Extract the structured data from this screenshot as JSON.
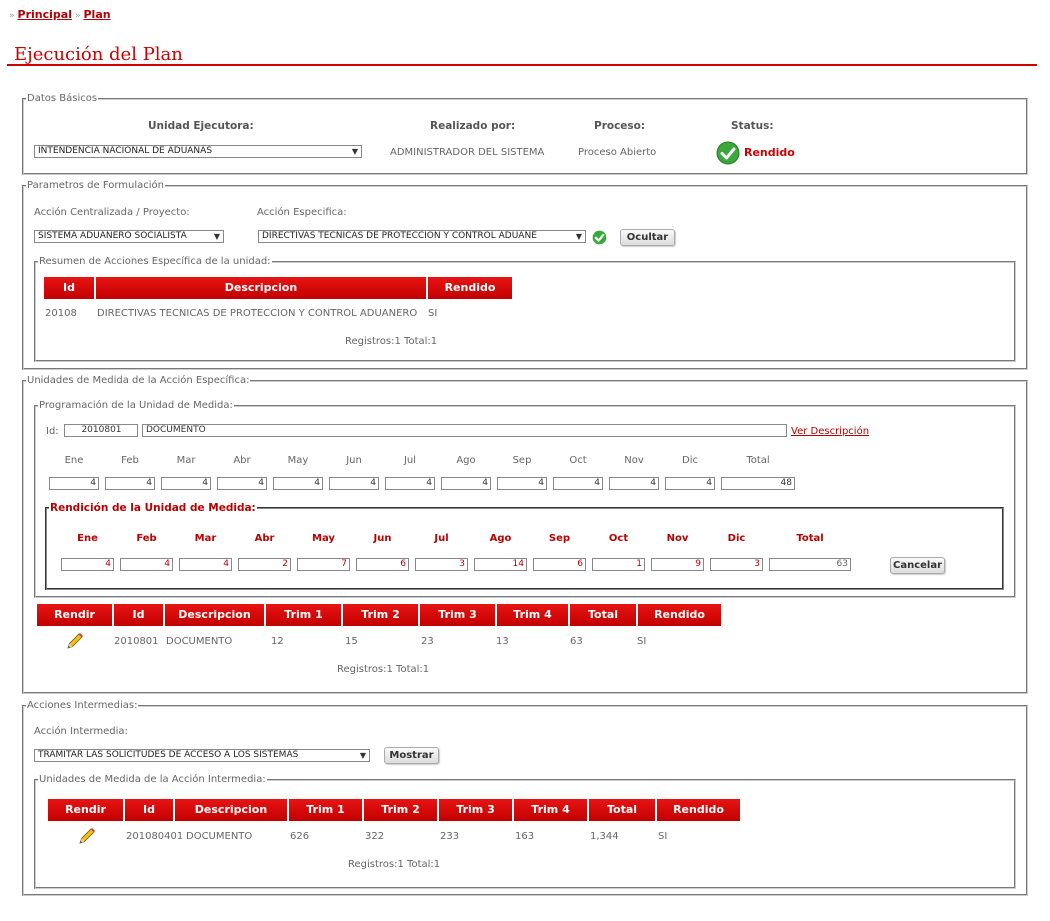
{
  "breadcrumb": {
    "home": "Principal",
    "current": "Plan",
    "sep": "»"
  },
  "page_title": "Ejecución del Plan",
  "datos": {
    "legend": "Datos Básicos",
    "unidad_label": "Unidad Ejecutora:",
    "realizado_label": "Realizado por:",
    "proceso_label": "Proceso:",
    "status_label": "Status:",
    "unidad_value": "INTENDENCIA NACIONAL DE ADUANAS",
    "realizado_value": "ADMINISTRADOR DEL SISTEMA",
    "proceso_value": "Proceso Abierto",
    "status_value": "Rendido"
  },
  "parametros": {
    "legend": "Parametros de Formulación",
    "accion_label": "Acción Centralizada / Proyecto:",
    "especifica_label": "Acción Especifica:",
    "accion_value": "SISTEMA ADUANERO SOCIALISTA",
    "especifica_value": "DIRECTIVAS TECNICAS DE PROTECCION Y CONTROL ADUANE",
    "ocultar": "Ocultar",
    "resumen": {
      "legend": "Resumen de Acciones Específica de la unidad:",
      "headers": [
        "Id",
        "Descripcion",
        "Rendido"
      ],
      "row": [
        "20108",
        "DIRECTIVAS TECNICAS DE PROTECCION Y CONTROL ADUANERO",
        "SI"
      ],
      "footer": "Registros:1 Total:1"
    }
  },
  "unidades": {
    "legend": "Unidades de Medida de la Acción Específica:",
    "prog": {
      "legend": "Programación de la Unidad de Medida:",
      "id_label": "Id:",
      "id_value": "2010801",
      "desc_value": "DOCUMENTO",
      "ver_desc": "Ver Descripción",
      "months": [
        "Ene",
        "Feb",
        "Mar",
        "Abr",
        "May",
        "Jun",
        "Jul",
        "Ago",
        "Sep",
        "Oct",
        "Nov",
        "Dic"
      ],
      "total_label": "Total",
      "values": [
        "4",
        "4",
        "4",
        "4",
        "4",
        "4",
        "4",
        "4",
        "4",
        "4",
        "4",
        "4"
      ],
      "total": "48"
    },
    "rend": {
      "legend": "Rendición de la Unidad de Medida:",
      "months": [
        "Ene",
        "Feb",
        "Mar",
        "Abr",
        "May",
        "Jun",
        "Jul",
        "Ago",
        "Sep",
        "Oct",
        "Nov",
        "Dic"
      ],
      "total_label": "Total",
      "values": [
        "4",
        "4",
        "4",
        "2",
        "7",
        "6",
        "3",
        "14",
        "6",
        "1",
        "9",
        "3"
      ],
      "total": "63",
      "cancelar": "Cancelar"
    },
    "table": {
      "headers": [
        "Rendir",
        "Id",
        "Descripcion",
        "Trim 1",
        "Trim 2",
        "Trim 3",
        "Trim 4",
        "Total",
        "Rendido"
      ],
      "row": [
        "2010801",
        "DOCUMENTO",
        "12",
        "15",
        "23",
        "13",
        "63",
        "SI"
      ],
      "footer": "Registros:1 Total:1"
    }
  },
  "intermedias": {
    "legend": "Acciones Intermedias:",
    "accion_label": "Acción Intermedia:",
    "accion_value": "TRAMITAR LAS SOLICITUDES DE ACCESO A LOS SISTEMAS",
    "mostrar": "Mostrar",
    "sub": {
      "legend": "Unidades de Medida de la Acción Intermedia:",
      "headers": [
        "Rendir",
        "Id",
        "Descripcion",
        "Trim 1",
        "Trim 2",
        "Trim 3",
        "Trim 4",
        "Total",
        "Rendido"
      ],
      "row": [
        "201080401",
        "DOCUMENTO",
        "626",
        "322",
        "233",
        "163",
        "1,344",
        "SI"
      ],
      "footer": "Registros:1 Total:1"
    }
  },
  "colors": {
    "accent": "#cc0000",
    "header_red": "#d90000"
  }
}
